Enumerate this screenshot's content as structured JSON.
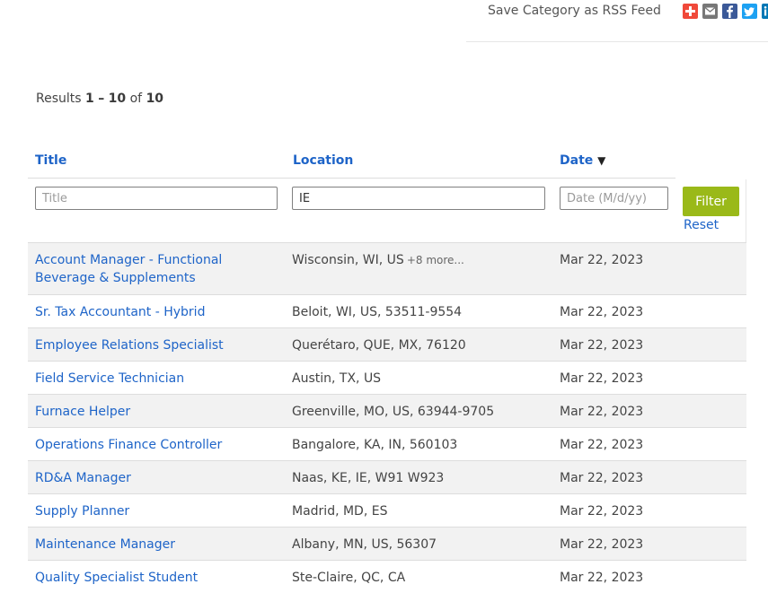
{
  "rss": {
    "label": "Save Category as RSS Feed",
    "share_icons": [
      "plus-icon",
      "email-icon",
      "facebook-icon",
      "twitter-icon",
      "linkedin-icon"
    ],
    "colors": {
      "plus": "#f0493a",
      "email": "#777777",
      "facebook": "#3b5998",
      "twitter": "#1da1f2",
      "linkedin": "#0077b5"
    }
  },
  "results": {
    "prefix": "Results",
    "range_start": "1",
    "dash": "–",
    "range_end": "10",
    "of": "of",
    "total": "10"
  },
  "table": {
    "headers": {
      "title": "Title",
      "location": "Location",
      "date": "Date",
      "date_sort_indicator": "▼"
    },
    "filters": {
      "title_placeholder": "Title",
      "location_value": "IE",
      "date_placeholder": "Date (M/d/yy)",
      "filter_button": "Filter",
      "reset_link": "Reset"
    },
    "rows": [
      {
        "title": "Account Manager - Functional Beverage & Supplements",
        "location": "Wisconsin, WI, US",
        "more": "+8 more...",
        "date": "Mar 22, 2023"
      },
      {
        "title": "Sr. Tax Accountant - Hybrid",
        "location": "Beloit, WI, US, 53511-9554",
        "date": "Mar 22, 2023"
      },
      {
        "title": "Employee Relations Specialist",
        "location": "Querétaro, QUE, MX, 76120",
        "date": "Mar 22, 2023"
      },
      {
        "title": "Field Service Technician",
        "location": "Austin, TX, US",
        "date": "Mar 22, 2023"
      },
      {
        "title": "Furnace Helper",
        "location": "Greenville, MO, US, 63944-9705",
        "date": "Mar 22, 2023"
      },
      {
        "title": "Operations Finance Controller",
        "location": "Bangalore, KA, IN, 560103",
        "date": "Mar 22, 2023"
      },
      {
        "title": "RD&A Manager",
        "location": "Naas, KE, IE, W91 W923",
        "date": "Mar 22, 2023"
      },
      {
        "title": "Supply Planner",
        "location": "Madrid, MD, ES",
        "date": "Mar 22, 2023"
      },
      {
        "title": "Maintenance Manager",
        "location": "Albany, MN, US, 56307",
        "date": "Mar 22, 2023"
      },
      {
        "title": "Quality Specialist Student",
        "location": "Ste-Claire, QC, CA",
        "date": "Mar 22, 2023"
      }
    ]
  },
  "colors": {
    "link": "#1e64c8",
    "filter_button": "#9ab919",
    "row_shade": "#f2f2f2"
  }
}
